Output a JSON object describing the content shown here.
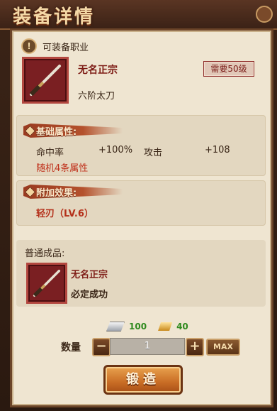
{
  "header": {
    "title": "装备详情"
  },
  "job": {
    "label": "可装备职业"
  },
  "item": {
    "name": "无名正宗",
    "requirement": "需要50级",
    "type": "六阶太刀"
  },
  "base_attributes": {
    "title": "基础属性:",
    "stats": [
      {
        "name": "命中率",
        "value": "+100%"
      },
      {
        "name": "攻击",
        "value": "+108"
      }
    ],
    "random_note": "随机4条属性"
  },
  "extra_effect": {
    "title": "附加效果:",
    "skill": "轻刃（LV.6）"
  },
  "normal_product": {
    "title": "普通成品:",
    "name": "无名正宗",
    "note": "必定成功"
  },
  "cost": {
    "silver": "100",
    "gold": "40"
  },
  "quantity": {
    "label": "数量",
    "value": "1",
    "minus": "−",
    "plus": "+",
    "max": "MAX"
  },
  "forge_button": "锻造",
  "colors": {
    "accent_red": "#c0321c",
    "item_bg": "#7a1f22",
    "cost_green": "#2f8a1e"
  }
}
